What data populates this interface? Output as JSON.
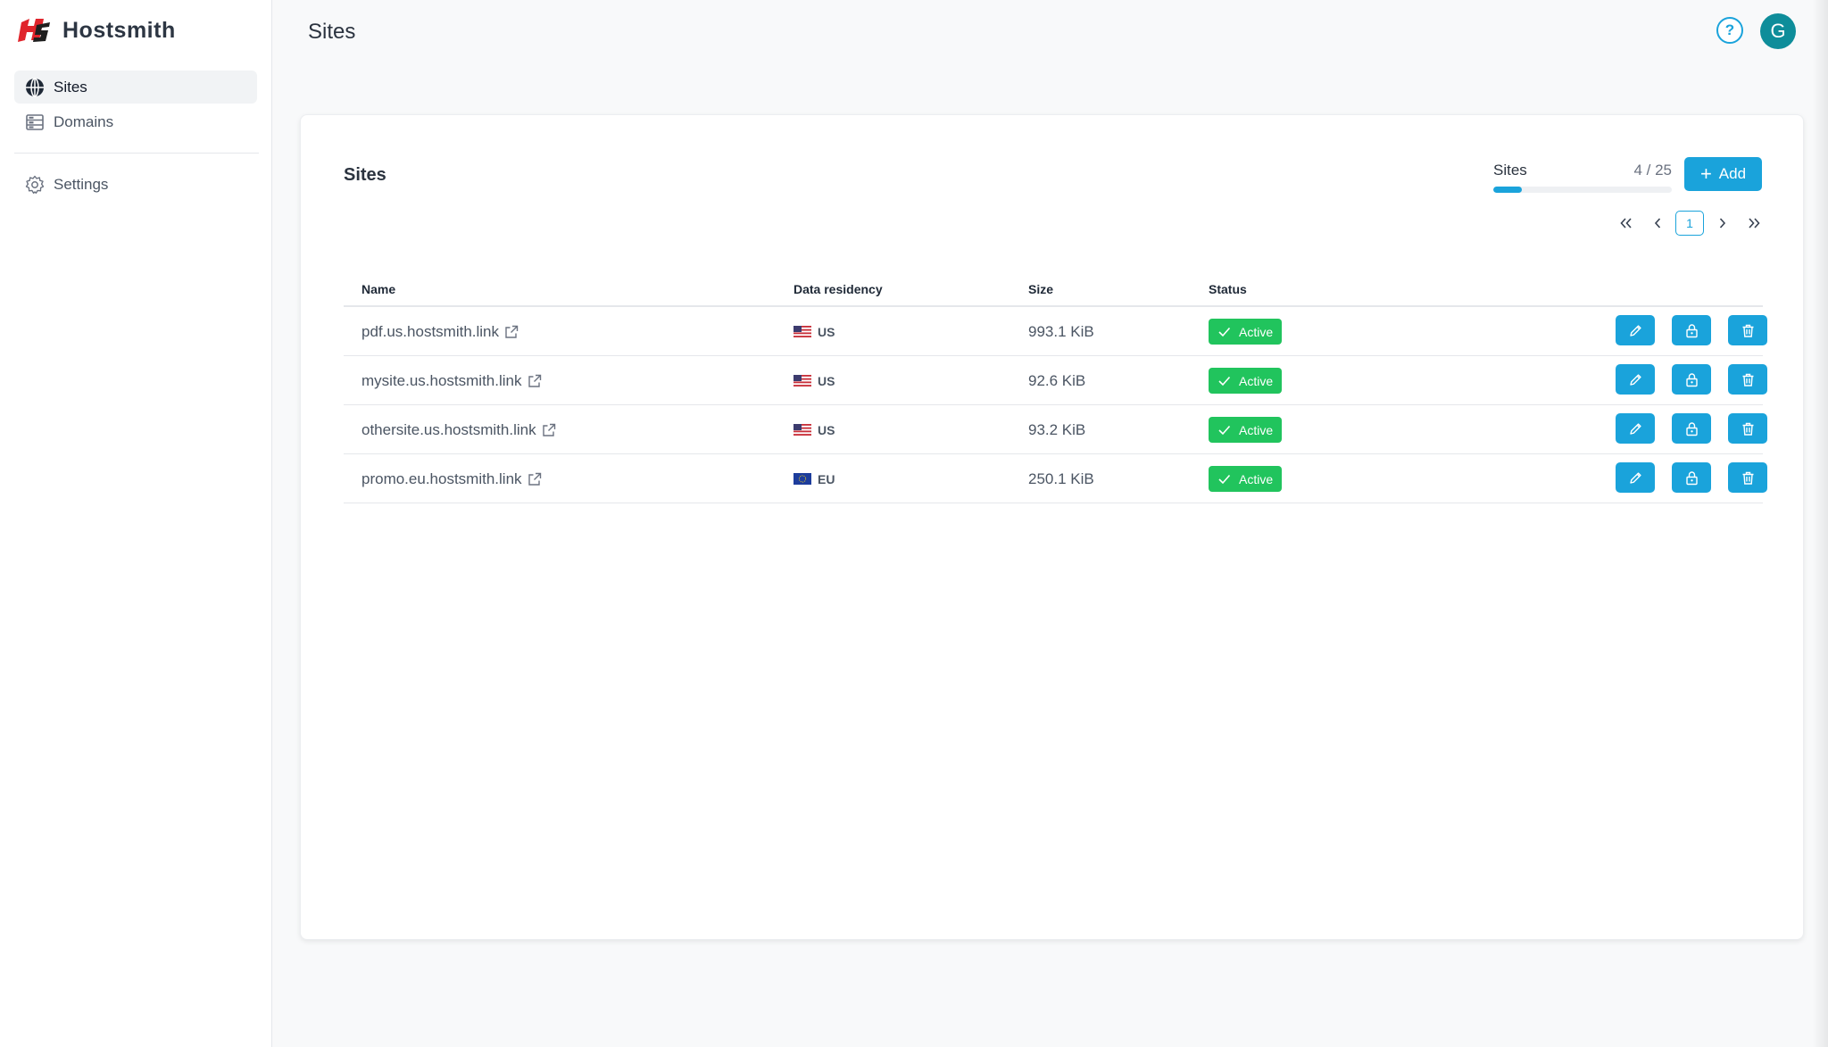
{
  "app": {
    "name": "Hostsmith"
  },
  "sidebar": {
    "items": [
      {
        "label": "Sites",
        "icon": "globe-icon",
        "active": true
      },
      {
        "label": "Domains",
        "icon": "server-icon",
        "active": false
      },
      {
        "label": "Settings",
        "icon": "gear-icon",
        "active": false
      }
    ]
  },
  "header": {
    "title": "Sites",
    "help_icon": "help-icon",
    "avatar_initial": "G"
  },
  "card": {
    "title": "Sites",
    "quota": {
      "label": "Sites",
      "value": "4 / 25",
      "used": 4,
      "total": 25
    },
    "add_label": "Add",
    "pager": {
      "current_page": "1"
    }
  },
  "table": {
    "columns": [
      "Name",
      "Data residency",
      "Size",
      "Status"
    ],
    "rows": [
      {
        "name": "pdf.us.hostsmith.link",
        "region": "US",
        "size": "993.1 KiB",
        "status": "Active"
      },
      {
        "name": "mysite.us.hostsmith.link",
        "region": "US",
        "size": "92.6 KiB",
        "status": "Active"
      },
      {
        "name": "othersite.us.hostsmith.link",
        "region": "US",
        "size": "93.2 KiB",
        "status": "Active"
      },
      {
        "name": "promo.eu.hostsmith.link",
        "region": "EU",
        "size": "250.1 KiB",
        "status": "Active"
      }
    ],
    "row_actions": [
      "edit-icon",
      "lock-icon",
      "trash-icon"
    ]
  },
  "colors": {
    "accent": "#1aa3db",
    "success": "#21c45d",
    "avatar": "#0e8d9a",
    "logo": "#e0242b"
  }
}
